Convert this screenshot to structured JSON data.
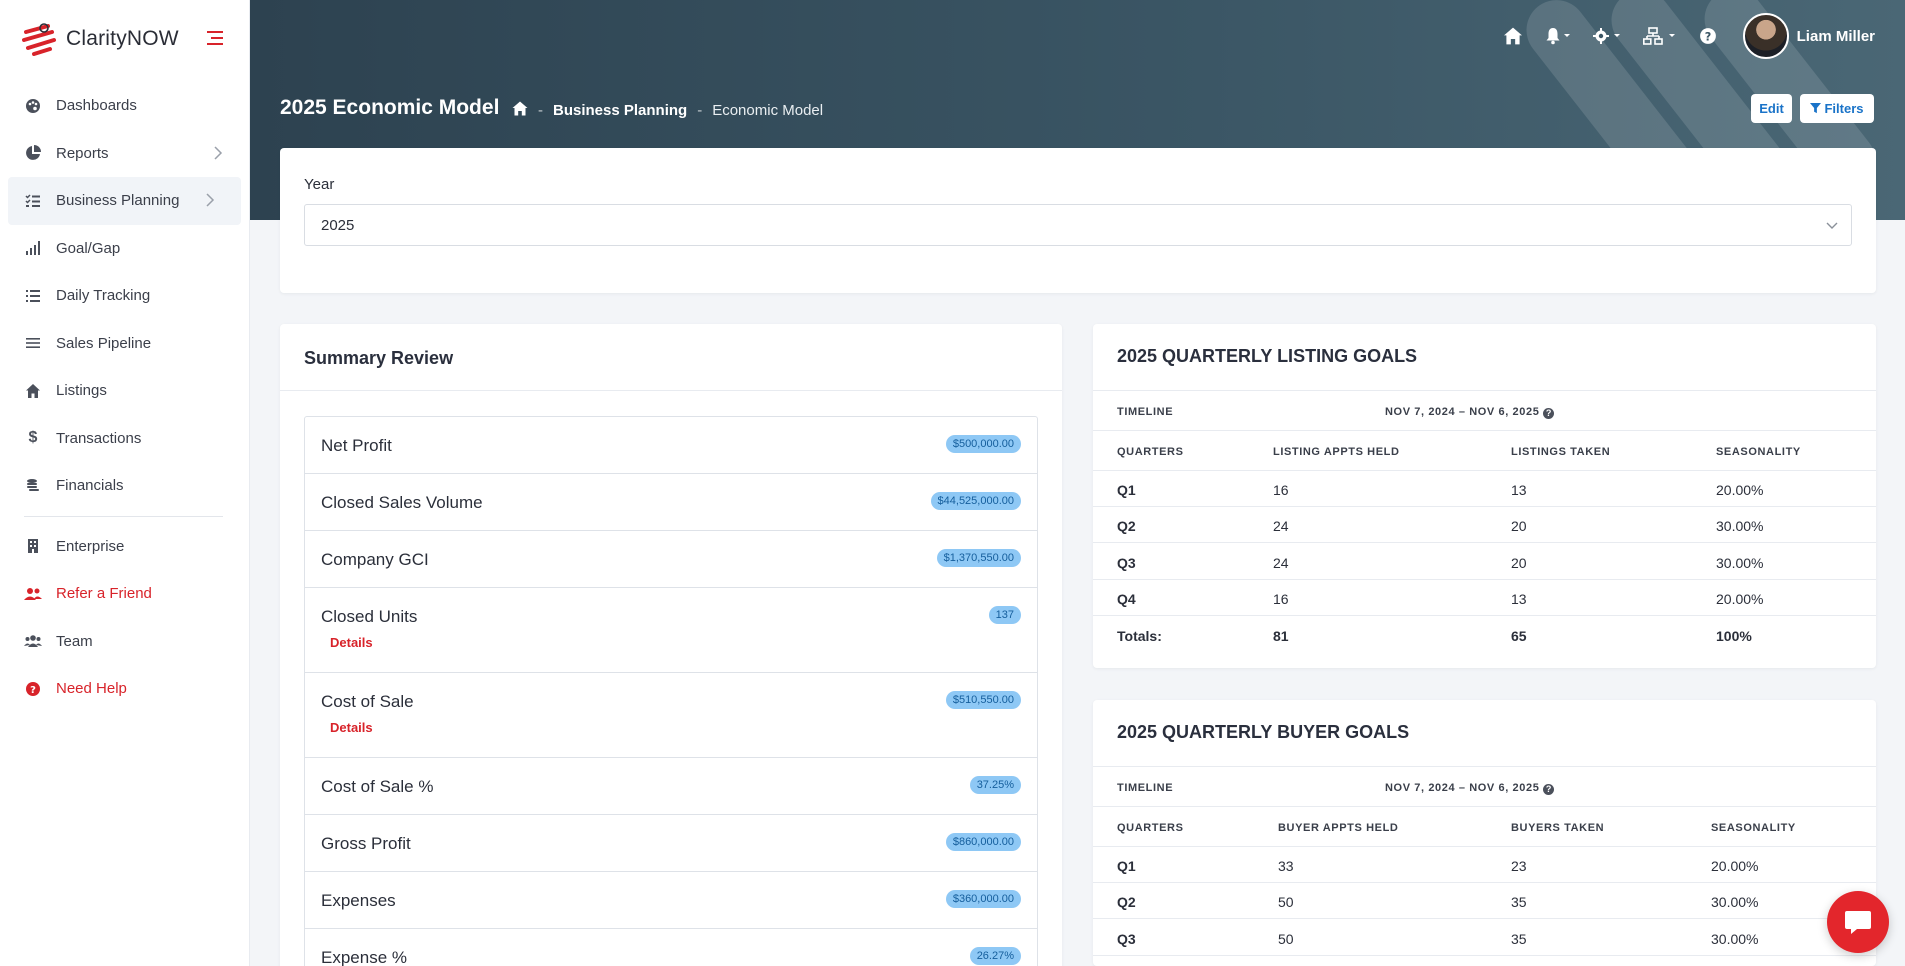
{
  "brand": {
    "name": "ClarityNOW"
  },
  "sidebar": {
    "items": [
      {
        "label": "Dashboards",
        "icon": "palette-icon"
      },
      {
        "label": "Reports",
        "icon": "pie-chart-icon",
        "has_chevron": true
      },
      {
        "label": "Business Planning",
        "icon": "tasks-list-icon",
        "has_chevron": true,
        "active": true
      },
      {
        "label": "Goal/Gap",
        "icon": "signal-bars-icon"
      },
      {
        "label": "Daily Tracking",
        "icon": "list-icon"
      },
      {
        "label": "Sales Pipeline",
        "icon": "lines-icon"
      },
      {
        "label": "Listings",
        "icon": "home-icon"
      },
      {
        "label": "Transactions",
        "icon": "dollar-icon"
      },
      {
        "label": "Financials",
        "icon": "coins-icon"
      },
      {
        "label": "Enterprise",
        "icon": "building-icon"
      },
      {
        "label": "Refer a Friend",
        "icon": "users-icon"
      },
      {
        "label": "Team",
        "icon": "team-icon"
      },
      {
        "label": "Need Help",
        "icon": "help-circle-icon"
      }
    ]
  },
  "topbar": {
    "user_name": "Liam Miller"
  },
  "header": {
    "title": "2025 Economic Model",
    "breadcrumb": [
      "Business Planning",
      "Economic Model"
    ],
    "edit_label": "Edit",
    "filters_label": "Filters"
  },
  "year": {
    "label": "Year",
    "value": "2025"
  },
  "summary": {
    "title": "Summary Review",
    "details_label": "Details",
    "rows": [
      {
        "label": "Net Profit",
        "value": "$500,000.00"
      },
      {
        "label": "Closed Sales Volume",
        "value": "$44,525,000.00"
      },
      {
        "label": "Company GCI",
        "value": "$1,370,550.00"
      },
      {
        "label": "Closed Units",
        "value": "137"
      },
      {
        "label": "Cost of Sale",
        "value": "$510,550.00"
      },
      {
        "label": "Cost of Sale %",
        "value": "37.25%"
      },
      {
        "label": "Gross Profit",
        "value": "$860,000.00"
      },
      {
        "label": "Expenses",
        "value": "$360,000.00"
      },
      {
        "label": "Expense %",
        "value": "26.27%"
      }
    ]
  },
  "listing_goals": {
    "title": "2025 QUARTERLY LISTING GOALS",
    "timeline_label": "TIMELINE",
    "timeline_value": "NOV 7, 2024 – NOV 6, 2025",
    "headers": [
      "QUARTERS",
      "LISTING APPTS HELD",
      "LISTINGS TAKEN",
      "SEASONALITY"
    ],
    "rows": [
      [
        "Q1",
        "16",
        "13",
        "20.00%"
      ],
      [
        "Q2",
        "24",
        "20",
        "30.00%"
      ],
      [
        "Q3",
        "24",
        "20",
        "30.00%"
      ],
      [
        "Q4",
        "16",
        "13",
        "20.00%"
      ]
    ],
    "totals": [
      "Totals:",
      "81",
      "65",
      "100%"
    ]
  },
  "buyer_goals": {
    "title": "2025 QUARTERLY BUYER GOALS",
    "timeline_label": "TIMELINE",
    "timeline_value": "NOV 7, 2024 – NOV 6, 2025",
    "headers": [
      "QUARTERS",
      "BUYER APPTS HELD",
      "BUYERS TAKEN",
      "SEASONALITY"
    ],
    "rows": [
      [
        "Q1",
        "33",
        "23",
        "20.00%"
      ],
      [
        "Q2",
        "50",
        "35",
        "30.00%"
      ],
      [
        "Q3",
        "50",
        "35",
        "30.00%"
      ]
    ]
  },
  "colors": {
    "accent": "#d8232a",
    "header": "#2d4250",
    "badge": "#8ec8f5",
    "link": "#1a73c8"
  }
}
